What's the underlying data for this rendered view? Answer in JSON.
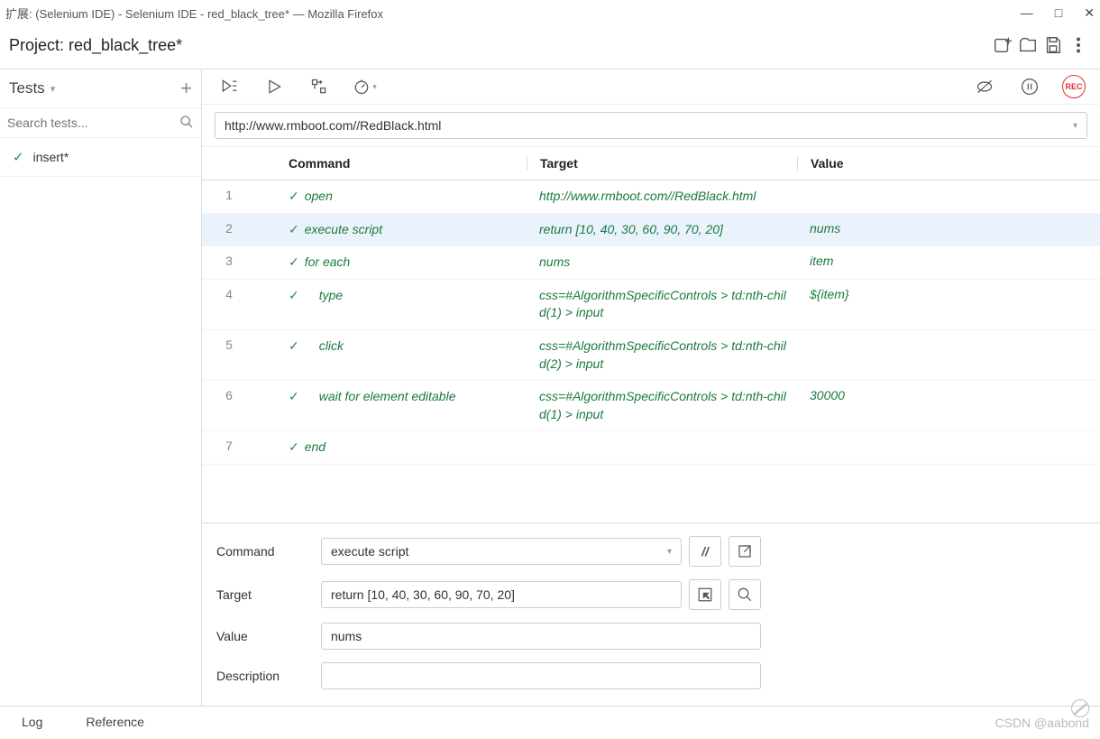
{
  "window": {
    "title": "扩展:   (Selenium IDE) - Selenium IDE - red_black_tree* — Mozilla Firefox"
  },
  "project": {
    "label": "Project:  red_black_tree*"
  },
  "sidebar": {
    "tests_label": "Tests",
    "search_placeholder": "Search tests...",
    "items": [
      {
        "name": "insert*"
      }
    ]
  },
  "url": "http://www.rmboot.com//RedBlack.html",
  "headers": {
    "command": "Command",
    "target": "Target",
    "value": "Value"
  },
  "rows": [
    {
      "n": "1",
      "cmd": "open",
      "tgt": "http://www.rmboot.com//RedBlack.html",
      "val": "",
      "indent": 0,
      "sel": false
    },
    {
      "n": "2",
      "cmd": "execute script",
      "tgt": "return [10, 40, 30, 60, 90, 70, 20]",
      "val": "nums",
      "indent": 0,
      "sel": true
    },
    {
      "n": "3",
      "cmd": "for each",
      "tgt": "nums",
      "val": "item",
      "indent": 0,
      "sel": false
    },
    {
      "n": "4",
      "cmd": "type",
      "tgt": "css=#AlgorithmSpecificControls > td:nth-child(1) > input",
      "val": "${item}",
      "indent": 1,
      "sel": false
    },
    {
      "n": "5",
      "cmd": "click",
      "tgt": "css=#AlgorithmSpecificControls > td:nth-child(2) > input",
      "val": "",
      "indent": 1,
      "sel": false
    },
    {
      "n": "6",
      "cmd": "wait for element editable",
      "tgt": "css=#AlgorithmSpecificControls > td:nth-child(1) > input",
      "val": "30000",
      "indent": 1,
      "sel": false
    },
    {
      "n": "7",
      "cmd": "end",
      "tgt": "",
      "val": "",
      "indent": 0,
      "sel": false
    }
  ],
  "detail": {
    "labels": {
      "command": "Command",
      "target": "Target",
      "value": "Value",
      "description": "Description"
    },
    "command": "execute script",
    "target": "return [10, 40, 30, 60, 90, 70, 20]",
    "value": "nums",
    "description": ""
  },
  "footer": {
    "log": "Log",
    "reference": "Reference"
  },
  "watermark": "CSDN @aabond"
}
